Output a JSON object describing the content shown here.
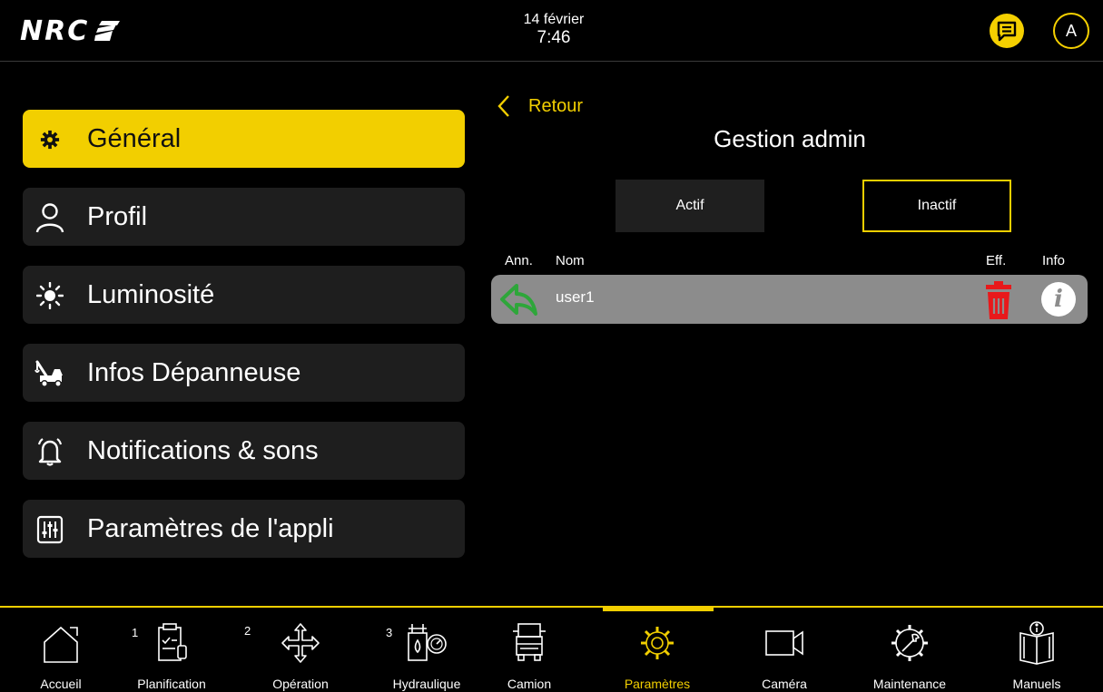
{
  "header": {
    "logo": "NRC",
    "date": "14 février",
    "time": "7:46",
    "avatar_initial": "A"
  },
  "sidebar": {
    "items": [
      {
        "label": "Général",
        "icon": "gear-icon",
        "active": true
      },
      {
        "label": "Profil",
        "icon": "user-icon"
      },
      {
        "label": "Luminosité",
        "icon": "sun-icon"
      },
      {
        "label": "Infos Dépanneuse",
        "icon": "tow-truck-icon"
      },
      {
        "label": "Notifications & sons",
        "icon": "bell-icon"
      },
      {
        "label": "Paramètres de l'appli",
        "icon": "sliders-icon"
      }
    ]
  },
  "content": {
    "back_label": "Retour",
    "title": "Gestion admin",
    "tabs": [
      {
        "label": "Actif"
      },
      {
        "label": "Inactif",
        "selected": true
      }
    ],
    "columns": {
      "restore": "Ann.",
      "name": "Nom",
      "delete": "Eff.",
      "info": "Info"
    },
    "users": [
      {
        "name": "user1"
      }
    ]
  },
  "bottom_nav": {
    "items": [
      {
        "label": "Accueil",
        "icon": "home-icon"
      },
      {
        "label": "Planification",
        "icon": "planning-icon",
        "badge": "1"
      },
      {
        "label": "Opération",
        "icon": "move-arrows-icon",
        "badge": "2"
      },
      {
        "label": "Hydraulique",
        "icon": "hydraulic-icon",
        "badge": "3"
      },
      {
        "label": "Camion",
        "icon": "truck-icon"
      },
      {
        "label": "Paramètres",
        "icon": "gears-icon",
        "active": true
      },
      {
        "label": "Caméra",
        "icon": "camera-icon"
      },
      {
        "label": "Maintenance",
        "icon": "wrench-gear-icon"
      },
      {
        "label": "Manuels",
        "icon": "manual-icon"
      }
    ]
  },
  "colors": {
    "accent": "#f2cf00",
    "row_bg": "#8c8c8c",
    "delete": "#e8191b",
    "restore": "#2ea63a"
  }
}
